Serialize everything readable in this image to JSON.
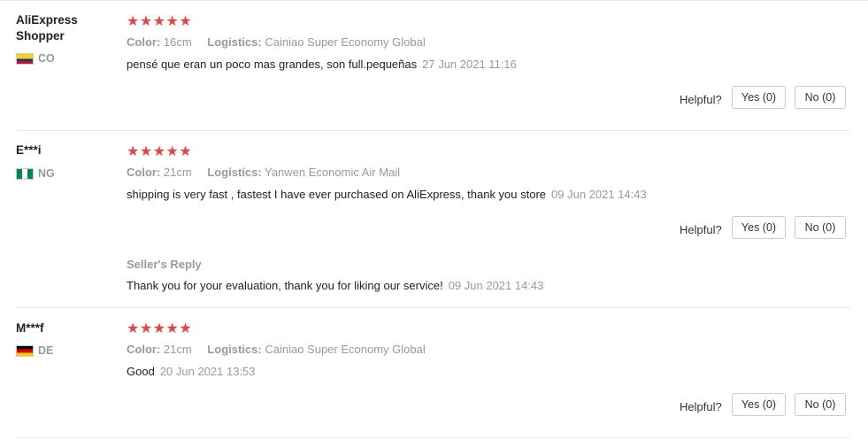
{
  "helpful_label": "Helpful?",
  "reviews": [
    {
      "user": "AliExpress Shopper",
      "country": "CO",
      "flag": "flag-co",
      "stars": "★★★★★",
      "color_label": "Color:",
      "color": "16cm",
      "logistics_label": "Logistics:",
      "logistics": "Cainiao Super Economy Global",
      "text": "pensé que eran un poco mas grandes, son full.pequeñas",
      "date": "27 Jun 2021 11:16",
      "yes": "Yes (0)",
      "no": "No (0)"
    },
    {
      "user": "E***i",
      "country": "NG",
      "flag": "flag-ng",
      "stars": "★★★★★",
      "color_label": "Color:",
      "color": "21cm",
      "logistics_label": "Logistics:",
      "logistics": "Yanwen Economic Air Mail",
      "text": "shipping is very fast , fastest I have ever purchased on AliExpress, thank you store",
      "date": "09 Jun 2021 14:43",
      "yes": "Yes (0)",
      "no": "No (0)",
      "reply": {
        "title": "Seller's Reply",
        "text": "Thank you for your evaluation, thank you for liking our service!",
        "date": "09 Jun 2021 14:43"
      }
    },
    {
      "user": "M***f",
      "country": "DE",
      "flag": "flag-de",
      "stars": "★★★★★",
      "color_label": "Color:",
      "color": "21cm",
      "logistics_label": "Logistics:",
      "logistics": "Cainiao Super Economy Global",
      "text": "Good",
      "date": "20 Jun 2021 13:53",
      "yes": "Yes (0)",
      "no": "No (0)"
    }
  ]
}
